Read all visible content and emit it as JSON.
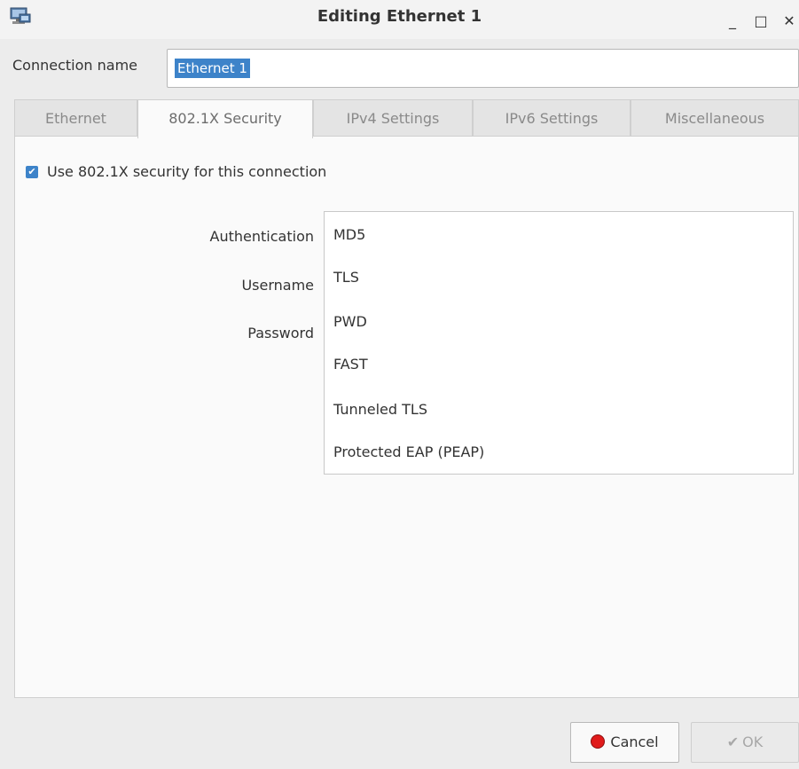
{
  "window": {
    "title": "Editing Ethernet 1",
    "app_icon": "network-connection-icon",
    "controls": {
      "minimize": "_",
      "maximize": "□",
      "close": "✕"
    }
  },
  "connection": {
    "label": "Connection name",
    "value": "Ethernet 1"
  },
  "tabs": [
    {
      "label": "Ethernet",
      "active": false
    },
    {
      "label": "802.1X Security",
      "active": true
    },
    {
      "label": "IPv4 Settings",
      "active": false
    },
    {
      "label": "IPv6 Settings",
      "active": false
    },
    {
      "label": "Miscellaneous",
      "active": false
    }
  ],
  "security": {
    "use_8021x_label": "Use 802.1X security for this connection",
    "use_8021x_checked": true,
    "fields": {
      "authentication_label": "Authentication",
      "username_label": "Username",
      "password_label": "Password"
    },
    "auth_options": [
      "MD5",
      "TLS",
      "PWD",
      "FAST",
      "Tunneled TLS",
      "Protected EAP (PEAP)"
    ]
  },
  "buttons": {
    "cancel": "Cancel",
    "ok": "OK",
    "ok_icon": "✔"
  },
  "colors": {
    "accent": "#3d83c9",
    "cancel_icon": "#e01b1b"
  }
}
